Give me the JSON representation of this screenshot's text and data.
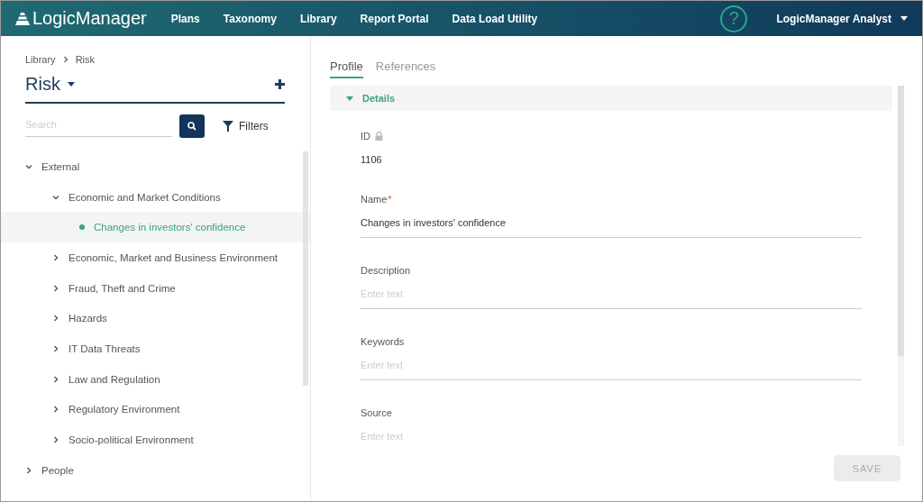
{
  "header": {
    "logo": "LogicManager",
    "nav": [
      {
        "label": "Plans"
      },
      {
        "label": "Taxonomy"
      },
      {
        "label": "Library"
      },
      {
        "label": "Report Portal"
      },
      {
        "label": "Data Load Utility"
      }
    ],
    "help": "?",
    "user": "LogicManager Analyst"
  },
  "sidebar": {
    "breadcrumb": [
      "Library",
      "Risk"
    ],
    "title": "Risk",
    "search": {
      "placeholder": "Search"
    },
    "filters": "Filters",
    "tree": [
      {
        "label": "External",
        "expanded": true,
        "children": [
          {
            "label": "Economic and Market Conditions",
            "expanded": true,
            "children": [
              {
                "label": "Changes in investors' confidence",
                "selected": true
              }
            ]
          },
          {
            "label": "Economic, Market and Business Environment",
            "expanded": false
          },
          {
            "label": "Fraud, Theft and Crime",
            "expanded": false
          },
          {
            "label": "Hazards",
            "expanded": false
          },
          {
            "label": "IT Data Threats",
            "expanded": false
          },
          {
            "label": "Law and Regulation",
            "expanded": false
          },
          {
            "label": "Regulatory Environment",
            "expanded": false
          },
          {
            "label": "Socio-political Environment",
            "expanded": false
          }
        ]
      },
      {
        "label": "People",
        "expanded": false
      }
    ]
  },
  "tabs": [
    {
      "label": "Profile",
      "selected": true
    },
    {
      "label": "References",
      "selected": false
    }
  ],
  "section": {
    "title": "Details",
    "expanded": true
  },
  "fields": [
    {
      "kind": "readonly",
      "label": "ID",
      "locked": true,
      "value": "1106"
    },
    {
      "kind": "input",
      "label": "Name",
      "required_mark": "*",
      "value": "Changes in investors' confidence"
    },
    {
      "kind": "input",
      "label": "Description",
      "placeholder": "Enter text"
    },
    {
      "kind": "input",
      "label": "Keywords",
      "placeholder": "Enter text"
    },
    {
      "kind": "input",
      "label": "Source",
      "placeholder": "Enter text"
    }
  ],
  "save": {
    "label": "SAVE",
    "disabled": true
  }
}
